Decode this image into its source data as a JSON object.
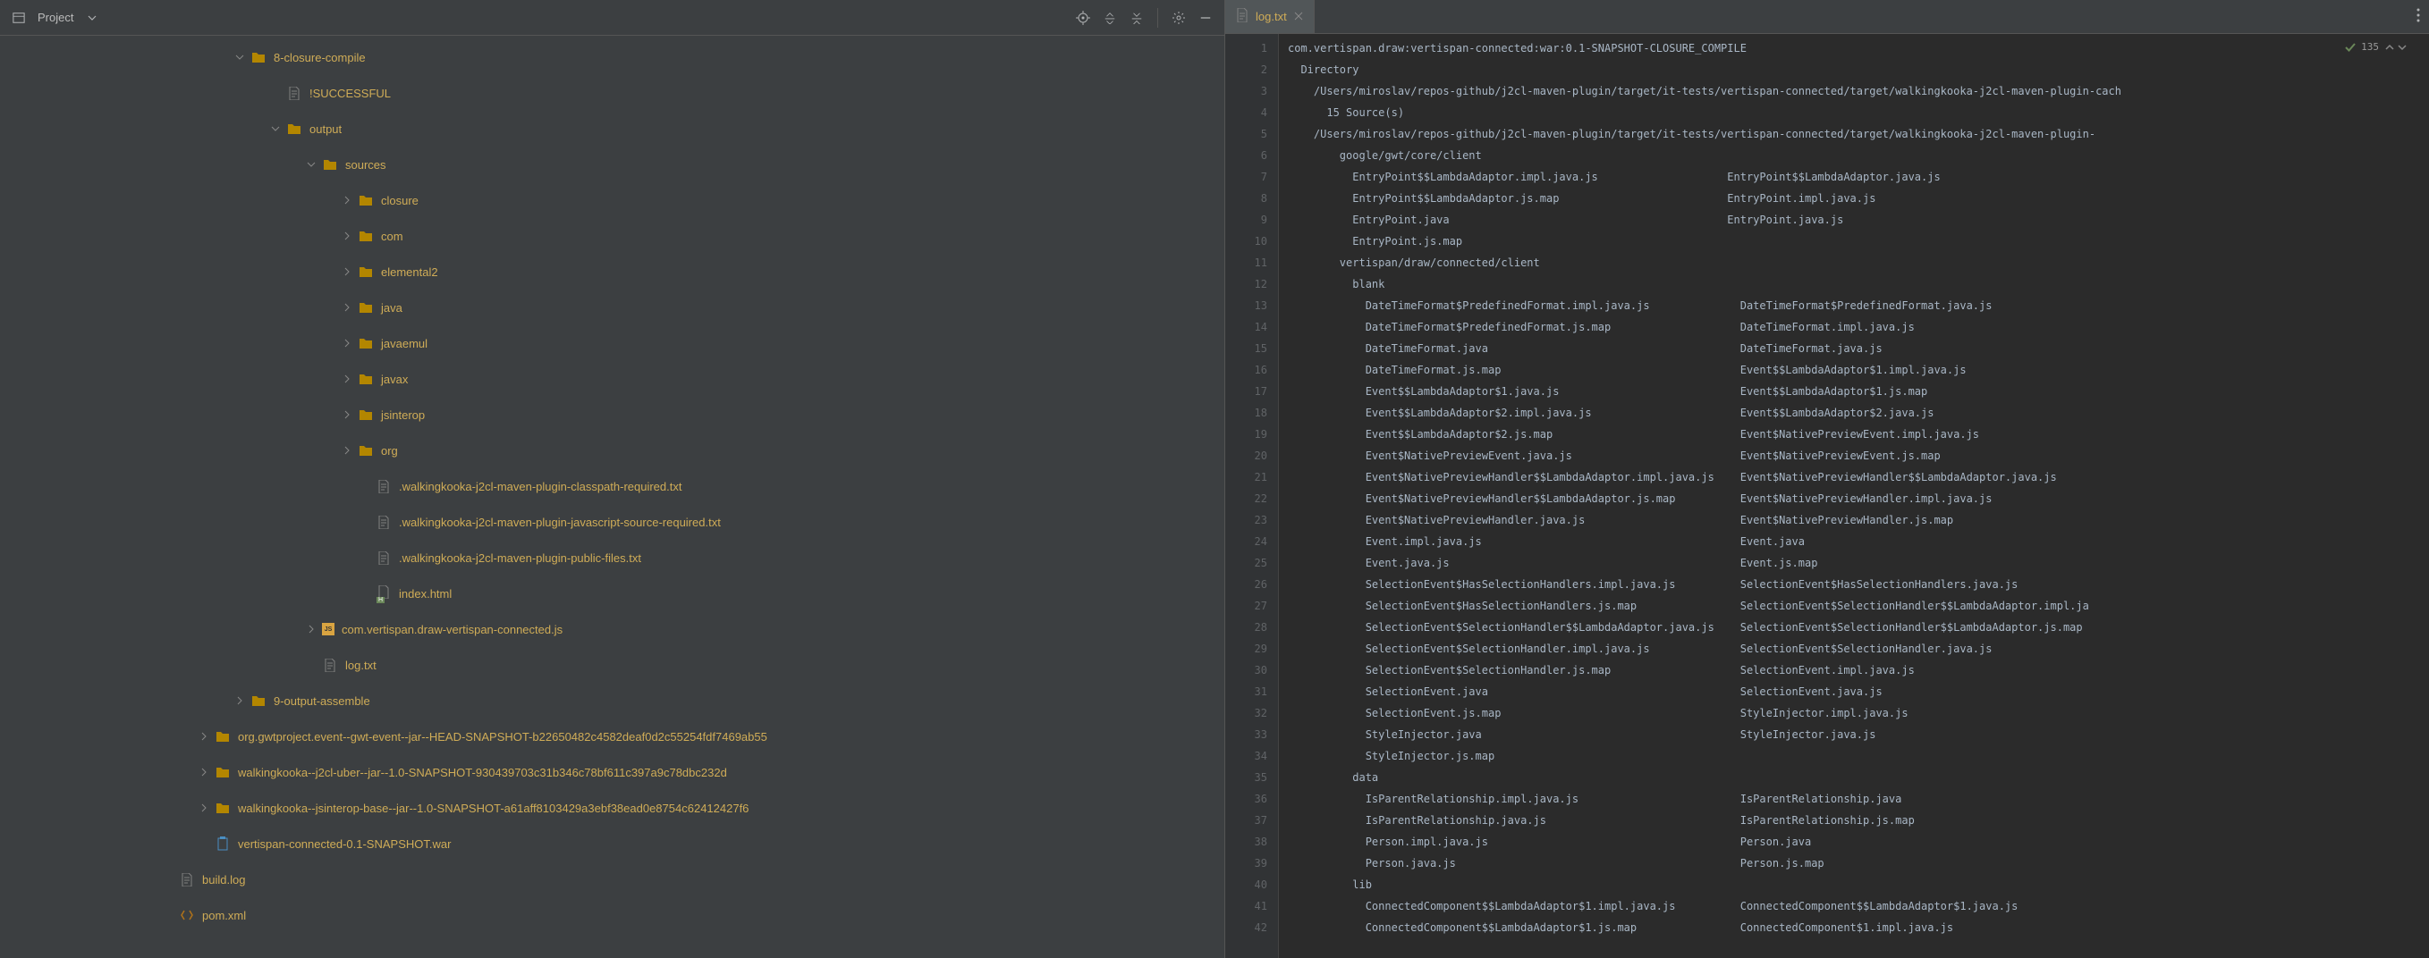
{
  "left_toolbar": {
    "project_label": "Project"
  },
  "tree": [
    {
      "indent": 260,
      "arrow": "down",
      "icon": "folder",
      "label": "8-closure-compile"
    },
    {
      "indent": 300,
      "arrow": "none",
      "icon": "file",
      "label": "!SUCCESSFUL"
    },
    {
      "indent": 300,
      "arrow": "down",
      "icon": "folder",
      "label": "output"
    },
    {
      "indent": 340,
      "arrow": "down",
      "icon": "folder",
      "label": "sources"
    },
    {
      "indent": 380,
      "arrow": "right",
      "icon": "folder",
      "label": "closure"
    },
    {
      "indent": 380,
      "arrow": "right",
      "icon": "folder",
      "label": "com"
    },
    {
      "indent": 380,
      "arrow": "right",
      "icon": "folder",
      "label": "elemental2"
    },
    {
      "indent": 380,
      "arrow": "right",
      "icon": "folder",
      "label": "java"
    },
    {
      "indent": 380,
      "arrow": "right",
      "icon": "folder",
      "label": "javaemul"
    },
    {
      "indent": 380,
      "arrow": "right",
      "icon": "folder",
      "label": "javax"
    },
    {
      "indent": 380,
      "arrow": "right",
      "icon": "folder",
      "label": "jsinterop"
    },
    {
      "indent": 380,
      "arrow": "right",
      "icon": "folder",
      "label": "org"
    },
    {
      "indent": 400,
      "arrow": "none",
      "icon": "file",
      "label": ".walkingkooka-j2cl-maven-plugin-classpath-required.txt"
    },
    {
      "indent": 400,
      "arrow": "none",
      "icon": "file",
      "label": ".walkingkooka-j2cl-maven-plugin-javascript-source-required.txt"
    },
    {
      "indent": 400,
      "arrow": "none",
      "icon": "file",
      "label": ".walkingkooka-j2cl-maven-plugin-public-files.txt"
    },
    {
      "indent": 400,
      "arrow": "none",
      "icon": "html",
      "label": "index.html"
    },
    {
      "indent": 340,
      "arrow": "right",
      "icon": "js",
      "label": "com.vertispan.draw-vertispan-connected.js"
    },
    {
      "indent": 340,
      "arrow": "none",
      "icon": "file",
      "label": "log.txt"
    },
    {
      "indent": 260,
      "arrow": "right",
      "icon": "folder",
      "label": "9-output-assemble"
    },
    {
      "indent": 220,
      "arrow": "right",
      "icon": "folder",
      "label": "org.gwtproject.event--gwt-event--jar--HEAD-SNAPSHOT-b22650482c4582deaf0d2c55254fdf7469ab55"
    },
    {
      "indent": 220,
      "arrow": "right",
      "icon": "folder",
      "label": "walkingkooka--j2cl-uber--jar--1.0-SNAPSHOT-930439703c31b346c78bf611c397a9c78dbc232d"
    },
    {
      "indent": 220,
      "arrow": "right",
      "icon": "folder",
      "label": "walkingkooka--jsinterop-base--jar--1.0-SNAPSHOT-a61aff8103429a3ebf38ead0e8754c62412427f6"
    },
    {
      "indent": 220,
      "arrow": "none",
      "icon": "war",
      "label": "vertispan-connected-0.1-SNAPSHOT.war"
    },
    {
      "indent": 180,
      "arrow": "none",
      "icon": "file",
      "label": "build.log"
    },
    {
      "indent": 180,
      "arrow": "none",
      "icon": "xml",
      "label": "pom.xml"
    }
  ],
  "tab": {
    "label": "log.txt"
  },
  "inspection": {
    "count": "135"
  },
  "code": [
    {
      "n": 1,
      "t": "com.vertispan.draw:vertispan-connected:war:0.1-SNAPSHOT-CLOSURE_COMPILE"
    },
    {
      "n": 2,
      "t": "  Directory"
    },
    {
      "n": 3,
      "t": "    /Users/miroslav/repos-github/j2cl-maven-plugin/target/it-tests/vertispan-connected/target/walkingkooka-j2cl-maven-plugin-cach"
    },
    {
      "n": 4,
      "t": "      15 Source(s)"
    },
    {
      "n": 5,
      "t": "    /Users/miroslav/repos-github/j2cl-maven-plugin/target/it-tests/vertispan-connected/target/walkingkooka-j2cl-maven-plugin-"
    },
    {
      "n": 6,
      "t": "        google/gwt/core/client"
    },
    {
      "n": 7,
      "t": "          EntryPoint$$LambdaAdaptor.impl.java.js                    EntryPoint$$LambdaAdaptor.java.js"
    },
    {
      "n": 8,
      "t": "          EntryPoint$$LambdaAdaptor.js.map                          EntryPoint.impl.java.js"
    },
    {
      "n": 9,
      "t": "          EntryPoint.java                                           EntryPoint.java.js"
    },
    {
      "n": 10,
      "t": "          EntryPoint.js.map"
    },
    {
      "n": 11,
      "t": "        vertispan/draw/connected/client"
    },
    {
      "n": 12,
      "t": "          blank"
    },
    {
      "n": 13,
      "t": "            DateTimeFormat$PredefinedFormat.impl.java.js              DateTimeFormat$PredefinedFormat.java.js"
    },
    {
      "n": 14,
      "t": "            DateTimeFormat$PredefinedFormat.js.map                    DateTimeFormat.impl.java.js"
    },
    {
      "n": 15,
      "t": "            DateTimeFormat.java                                       DateTimeFormat.java.js"
    },
    {
      "n": 16,
      "t": "            DateTimeFormat.js.map                                     Event$$LambdaAdaptor$1.impl.java.js"
    },
    {
      "n": 17,
      "t": "            Event$$LambdaAdaptor$1.java.js                            Event$$LambdaAdaptor$1.js.map"
    },
    {
      "n": 18,
      "t": "            Event$$LambdaAdaptor$2.impl.java.js                       Event$$LambdaAdaptor$2.java.js"
    },
    {
      "n": 19,
      "t": "            Event$$LambdaAdaptor$2.js.map                             Event$NativePreviewEvent.impl.java.js"
    },
    {
      "n": 20,
      "t": "            Event$NativePreviewEvent.java.js                          Event$NativePreviewEvent.js.map"
    },
    {
      "n": 21,
      "t": "            Event$NativePreviewHandler$$LambdaAdaptor.impl.java.js    Event$NativePreviewHandler$$LambdaAdaptor.java.js"
    },
    {
      "n": 22,
      "t": "            Event$NativePreviewHandler$$LambdaAdaptor.js.map          Event$NativePreviewHandler.impl.java.js"
    },
    {
      "n": 23,
      "t": "            Event$NativePreviewHandler.java.js                        Event$NativePreviewHandler.js.map"
    },
    {
      "n": 24,
      "t": "            Event.impl.java.js                                        Event.java"
    },
    {
      "n": 25,
      "t": "            Event.java.js                                             Event.js.map"
    },
    {
      "n": 26,
      "t": "            SelectionEvent$HasSelectionHandlers.impl.java.js          SelectionEvent$HasSelectionHandlers.java.js"
    },
    {
      "n": 27,
      "t": "            SelectionEvent$HasSelectionHandlers.js.map                SelectionEvent$SelectionHandler$$LambdaAdaptor.impl.ja"
    },
    {
      "n": 28,
      "t": "            SelectionEvent$SelectionHandler$$LambdaAdaptor.java.js    SelectionEvent$SelectionHandler$$LambdaAdaptor.js.map"
    },
    {
      "n": 29,
      "t": "            SelectionEvent$SelectionHandler.impl.java.js              SelectionEvent$SelectionHandler.java.js"
    },
    {
      "n": 30,
      "t": "            SelectionEvent$SelectionHandler.js.map                    SelectionEvent.impl.java.js"
    },
    {
      "n": 31,
      "t": "            SelectionEvent.java                                       SelectionEvent.java.js"
    },
    {
      "n": 32,
      "t": "            SelectionEvent.js.map                                     StyleInjector.impl.java.js"
    },
    {
      "n": 33,
      "t": "            StyleInjector.java                                        StyleInjector.java.js"
    },
    {
      "n": 34,
      "t": "            StyleInjector.js.map"
    },
    {
      "n": 35,
      "t": "          data"
    },
    {
      "n": 36,
      "t": "            IsParentRelationship.impl.java.js                         IsParentRelationship.java"
    },
    {
      "n": 37,
      "t": "            IsParentRelationship.java.js                              IsParentRelationship.js.map"
    },
    {
      "n": 38,
      "t": "            Person.impl.java.js                                       Person.java"
    },
    {
      "n": 39,
      "t": "            Person.java.js                                            Person.js.map"
    },
    {
      "n": 40,
      "t": "          lib"
    },
    {
      "n": 41,
      "t": "            ConnectedComponent$$LambdaAdaptor$1.impl.java.js          ConnectedComponent$$LambdaAdaptor$1.java.js"
    },
    {
      "n": 42,
      "t": "            ConnectedComponent$$LambdaAdaptor$1.js.map                ConnectedComponent$1.impl.java.js"
    }
  ]
}
